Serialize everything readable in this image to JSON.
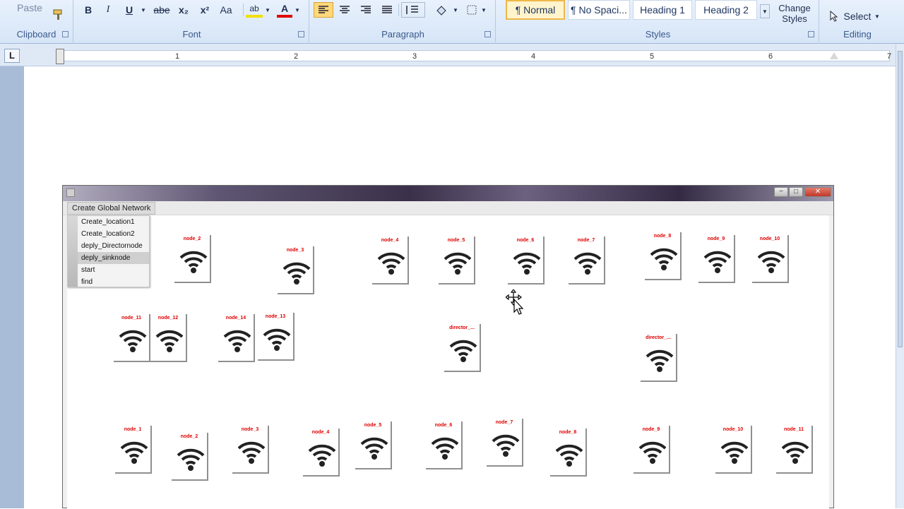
{
  "ribbon": {
    "clipboard": {
      "paste_label": "Paste",
      "group_label": "Clipboard"
    },
    "font": {
      "group_label": "Font",
      "bold": "B",
      "italic": "I",
      "underline": "U",
      "strike": "abe",
      "subscript": "x₂",
      "superscript": "x²",
      "case": "Aa",
      "highlight": "ab",
      "font_color": "A"
    },
    "paragraph": {
      "group_label": "Paragraph"
    },
    "styles": {
      "group_label": "Styles",
      "items": [
        "¶ Normal",
        "¶ No Spaci...",
        "Heading 1",
        "Heading 2"
      ],
      "change_styles": "Change Styles"
    },
    "editing": {
      "group_label": "Editing",
      "select_label": "Select"
    }
  },
  "ruler": {
    "numbers": [
      "1",
      "2",
      "3",
      "4",
      "5",
      "6",
      "7"
    ],
    "tab_marker": "L"
  },
  "app": {
    "menu_title": "Create Global Network",
    "dropdown_items": [
      "Create_location1",
      "Create_location2",
      "deply_Directornode",
      "deply_sinknode",
      "start",
      "find"
    ],
    "nodes": [
      {
        "label": "node_2"
      },
      {
        "label": "node_3"
      },
      {
        "label": "node_4"
      },
      {
        "label": "node_5"
      },
      {
        "label": "node_6"
      },
      {
        "label": "node_7"
      },
      {
        "label": "node_8"
      },
      {
        "label": "node_9"
      },
      {
        "label": "node_10"
      },
      {
        "label": "node_11"
      },
      {
        "label": "node_12"
      },
      {
        "label": "node_14"
      },
      {
        "label": "node_13"
      },
      {
        "label": "director_..."
      },
      {
        "label": "director_..."
      },
      {
        "label": "node_1"
      },
      {
        "label": "node_2"
      },
      {
        "label": "node_3"
      },
      {
        "label": "node_4"
      },
      {
        "label": "node_5"
      },
      {
        "label": "node_6"
      },
      {
        "label": "node_7"
      },
      {
        "label": "node_8"
      },
      {
        "label": "node_9"
      },
      {
        "label": "node_10"
      },
      {
        "label": "node_11"
      }
    ]
  },
  "colors": {
    "node_label": "#e00000",
    "ribbon_bg": "#dce8f7",
    "title_bar": "#3a3049"
  }
}
